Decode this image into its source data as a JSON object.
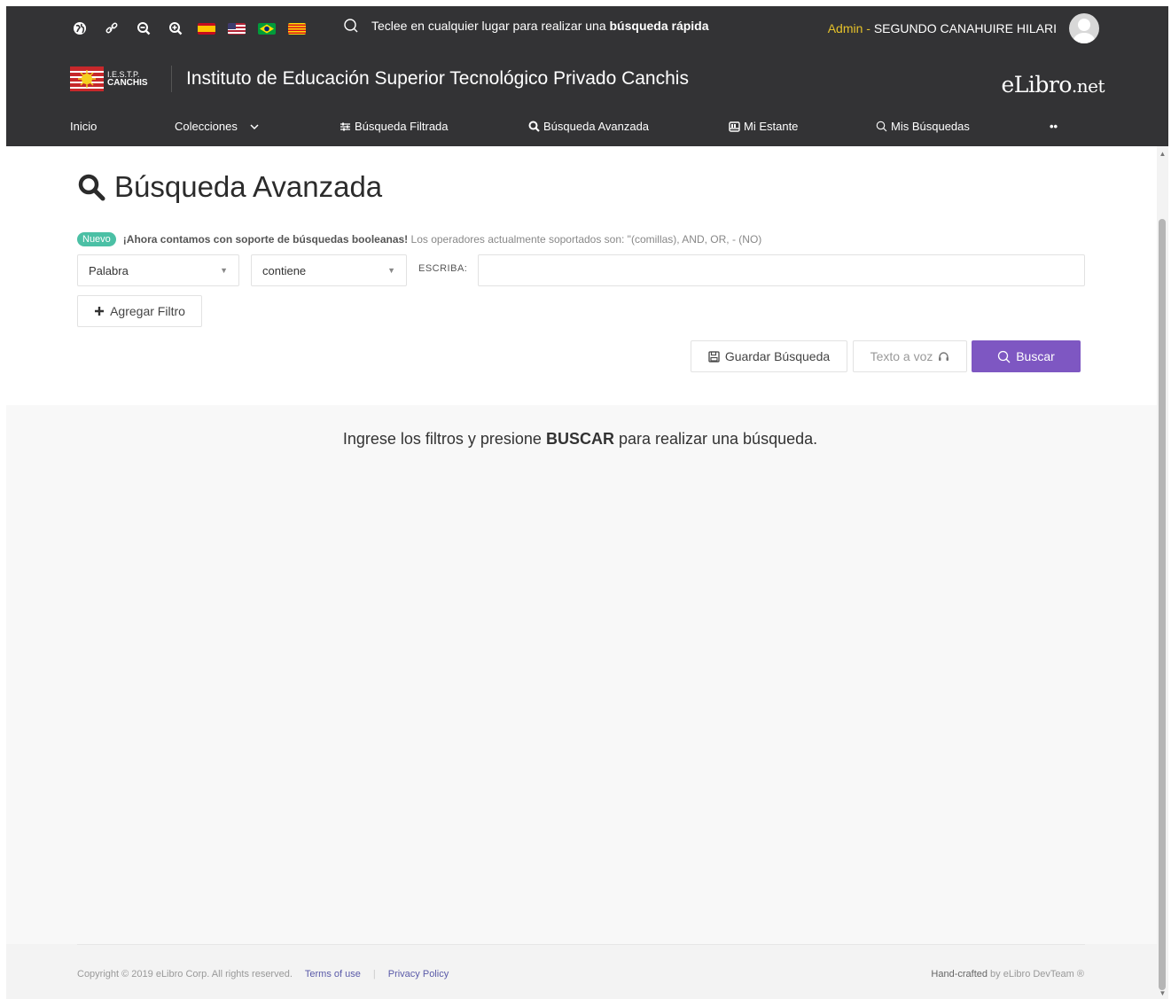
{
  "topbar": {
    "tools": [
      "globe-icon",
      "link-icon",
      "zoom-out-icon",
      "zoom-in-icon"
    ],
    "flags": [
      "flag-spain",
      "flag-usa",
      "flag-brazil",
      "flag-catalonia"
    ],
    "quick_search": {
      "prefix": "Teclee en cualquier lugar para realizar una ",
      "bold": "búsqueda rápida"
    },
    "user": {
      "role": "Admin",
      "separator": " - ",
      "name": "SEGUNDO CANAHUIRE HILARI"
    },
    "institution": {
      "logo_line1": "I.E.S.T.P.",
      "logo_line2": "CANCHIS",
      "name": "Instituto de Educación Superior Tecnológico Privado Canchis"
    },
    "brand": {
      "main": "eLibro",
      "suffix": ".net"
    }
  },
  "nav": {
    "inicio": "Inicio",
    "colecciones": "Colecciones",
    "filtrada": "Búsqueda Filtrada",
    "avanzada": "Búsqueda Avanzada",
    "estante": "Mi Estante",
    "mis_busquedas": "Mis Búsquedas",
    "more": "••"
  },
  "page": {
    "title": "Búsqueda Avanzada",
    "notice": {
      "badge": "Nuevo",
      "bold": "¡Ahora contamos con soporte de búsquedas booleanas!",
      "rest": "Los operadores actualmente soportados son: \"(comillas), AND, OR, - (NO)"
    },
    "filter": {
      "field": "Palabra",
      "operator": "contiene",
      "escriba_label": "ESCRIBA:",
      "value": ""
    },
    "add_filter": "Agregar Filtro",
    "save_search": "Guardar Búsqueda",
    "tts": "Texto a voz",
    "search": "Buscar"
  },
  "results": {
    "msg_prefix": "Ingrese los filtros y presione ",
    "msg_bold": "BUSCAR",
    "msg_suffix": " para realizar una búsqueda."
  },
  "footer": {
    "copyright": "Copyright © 2019 eLibro Corp. All rights reserved.",
    "terms": "Terms of use",
    "sep": "|",
    "privacy": "Privacy Policy",
    "crafted_bold": "Hand-crafted",
    "crafted_rest": " by eLibro DevTeam ®"
  },
  "colors": {
    "topbar_bg": "#333335",
    "accent": "#7e57c2",
    "badge": "#4bc0a5",
    "admin": "#e6c22a"
  }
}
